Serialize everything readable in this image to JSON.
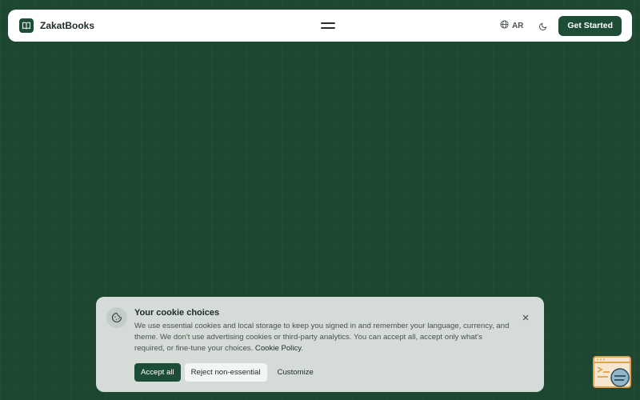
{
  "navbar": {
    "brand_name": "ZakatBooks",
    "language_label": "AR",
    "cta_label": "Get Started"
  },
  "icons": {
    "logo": "book-icon",
    "menu": "hamburger-menu-icon",
    "language": "globe-icon",
    "theme": "moon-icon",
    "cookie": "cookie-icon",
    "close": "close-icon",
    "dev_widget": "terminal-chat-icon"
  },
  "cookie_banner": {
    "title": "Your cookie choices",
    "body": "We use essential cookies and local storage to keep you signed in and remember your language, currency, and theme. We don't use advertising cookies or third-party analytics. You can accept all, accept only what's required, or fine-tune your choices.",
    "policy_link": "Cookie Policy",
    "policy_suffix": ".",
    "accept_all_label": "Accept all",
    "reject_label": "Reject non-essential",
    "customize_label": "Customize"
  },
  "colors": {
    "background": "#1d4731",
    "brand": "#1d4d37",
    "banner": "#d5dcd8",
    "widget_accent": "#e0a24a"
  }
}
